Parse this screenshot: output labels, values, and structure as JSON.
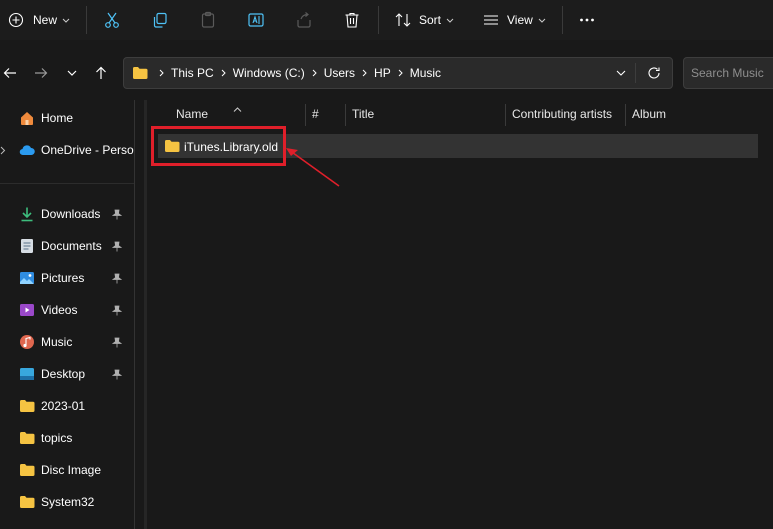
{
  "toolbar": {
    "new_label": "New",
    "sort_label": "Sort",
    "view_label": "View",
    "buttons": [
      "plus-circle-icon",
      "cut-icon",
      "copy-icon",
      "paste-icon",
      "rename-icon",
      "share-icon",
      "delete-icon",
      "sort-icon",
      "view-icon",
      "more-icon"
    ]
  },
  "navigation": {
    "breadcrumbs": [
      "This PC",
      "Windows (C:)",
      "Users",
      "HP",
      "Music"
    ],
    "search_placeholder": "Search Music"
  },
  "sidebar": {
    "items": [
      {
        "label": "Home",
        "icon": "home-icon",
        "pinned": false
      },
      {
        "label": "OneDrive - Perso",
        "icon": "cloud-icon",
        "pinned": false
      },
      {
        "label": "Downloads",
        "icon": "download-icon",
        "pinned": true
      },
      {
        "label": "Documents",
        "icon": "document-icon",
        "pinned": true
      },
      {
        "label": "Pictures",
        "icon": "picture-icon",
        "pinned": true
      },
      {
        "label": "Videos",
        "icon": "video-icon",
        "pinned": true
      },
      {
        "label": "Music",
        "icon": "music-icon",
        "pinned": true
      },
      {
        "label": "Desktop",
        "icon": "desktop-icon",
        "pinned": true
      },
      {
        "label": "2023-01",
        "icon": "folder-icon",
        "pinned": false
      },
      {
        "label": "topics",
        "icon": "folder-icon",
        "pinned": false
      },
      {
        "label": "Disc Image",
        "icon": "folder-icon",
        "pinned": false
      },
      {
        "label": "System32",
        "icon": "folder-icon",
        "pinned": false
      }
    ]
  },
  "columns": [
    "Name",
    "#",
    "Title",
    "Contributing artists",
    "Album"
  ],
  "files": [
    {
      "name": "iTunes.Library.old",
      "type": "folder",
      "selected": true
    }
  ],
  "colors": {
    "highlight": "#e01f2a",
    "folder": "#f5c342",
    "background": "#191919",
    "selection": "#333333"
  }
}
